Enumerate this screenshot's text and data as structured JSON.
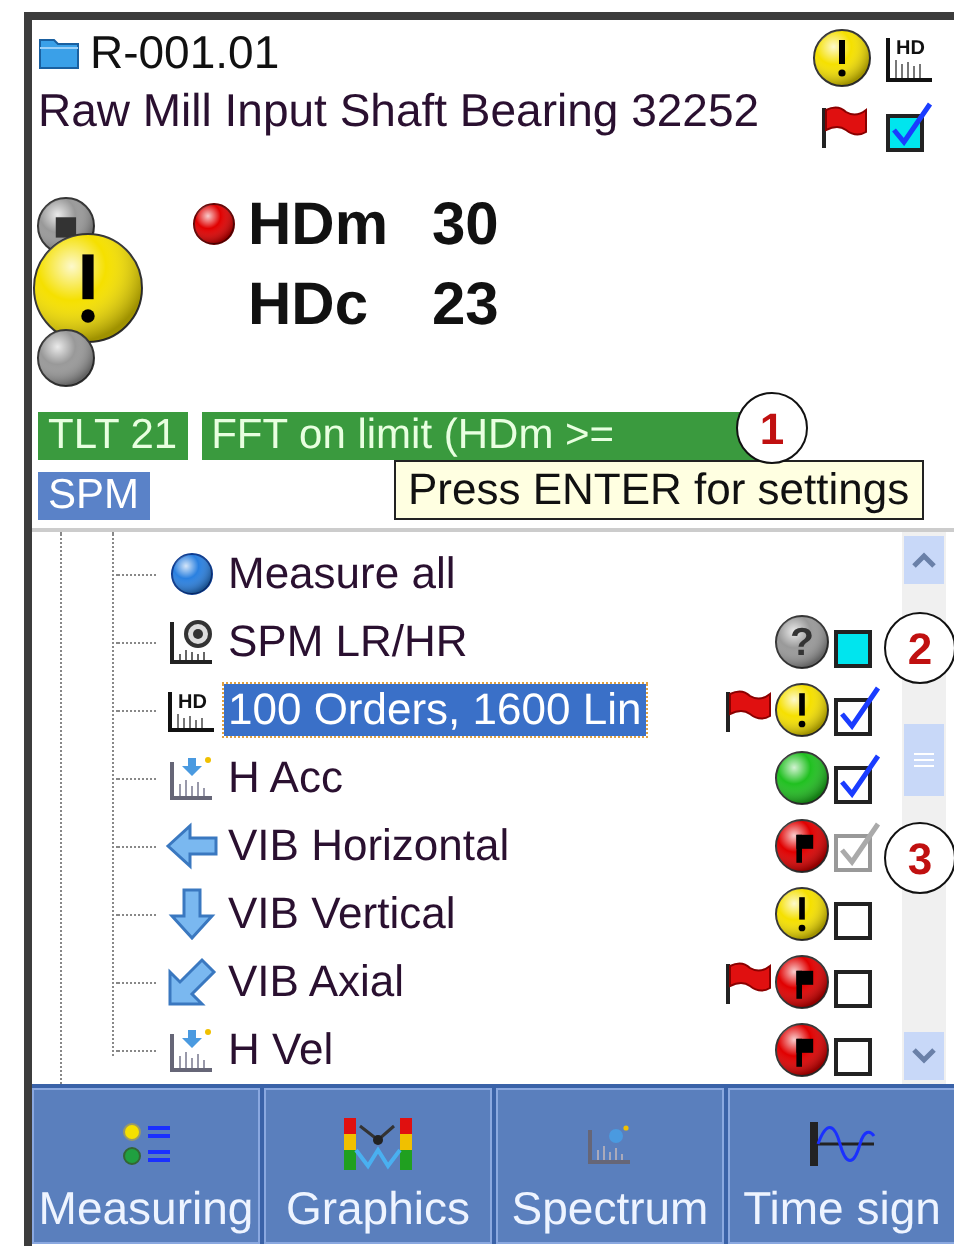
{
  "header": {
    "title": "R-001.01",
    "subtitle": "Raw Mill Input Shaft Bearing 32252",
    "color": "#f5e000",
    "icon_text": "HD",
    "flag": true,
    "checkbox": {
      "checked": true,
      "highlighted": true
    }
  },
  "readings": [
    {
      "label": "HDm",
      "value": "30",
      "alarm": true
    },
    {
      "label": "HDc",
      "value": "23",
      "alarm": false
    }
  ],
  "indicators": [
    {
      "color": "#999999",
      "symbol": "■"
    },
    {
      "color": "#f5e000"
    },
    {
      "color": "#999999"
    }
  ],
  "tags": [
    {
      "text": "TLT 21",
      "kind": "green"
    },
    {
      "text": "FFT on limit (HDm >=",
      "kind": "green"
    },
    {
      "text": "SPM",
      "kind": "blue"
    }
  ],
  "tooltip": "Press ENTER for settings",
  "tree": [
    {
      "label": "Measure all",
      "kind": "ball",
      "flag": false,
      "selected": false
    },
    {
      "label": "SPM LR/HR",
      "kind": "spm",
      "color": "#999999",
      "symbol": "?",
      "flag": false,
      "selected": false,
      "checkbox": {
        "checked": false,
        "disabled": false,
        "highlighted": true
      }
    },
    {
      "label": "100 Orders, 1600 Lin",
      "kind": "hd",
      "icon_text": "HD",
      "color": "#f5e000",
      "flag": true,
      "selected": true,
      "checkbox": {
        "checked": true,
        "disabled": false,
        "highlighted": false
      }
    },
    {
      "label": "H Acc",
      "kind": "chart",
      "color": "#20c020",
      "flag": false,
      "selected": false,
      "checkbox": {
        "checked": true,
        "disabled": false,
        "highlighted": false
      }
    },
    {
      "label": "VIB Horizontal",
      "kind": "arrow-left",
      "color": "#e00000",
      "flag": false,
      "selected": false,
      "checkbox": {
        "checked": true,
        "disabled": true,
        "highlighted": false
      }
    },
    {
      "label": "VIB Vertical",
      "kind": "arrow-down",
      "color": "#f5e000",
      "flag": false,
      "selected": false,
      "checkbox": {
        "checked": false,
        "disabled": false,
        "highlighted": false
      }
    },
    {
      "label": "VIB Axial",
      "kind": "arrow-diag",
      "color": "#e00000",
      "flag": true,
      "selected": false,
      "checkbox": {
        "checked": false,
        "disabled": false,
        "highlighted": false
      }
    },
    {
      "label": "H Vel",
      "kind": "chart",
      "color": "#e00000",
      "flag": false,
      "selected": false,
      "checkbox": {
        "checked": false,
        "disabled": false,
        "highlighted": false
      }
    }
  ],
  "toolbar": [
    {
      "label": "Measuring",
      "kind": "measuring"
    },
    {
      "label": "Graphics",
      "kind": "graphics"
    },
    {
      "label": "Spectrum",
      "kind": "spectrum"
    },
    {
      "label": "Time sign",
      "kind": "time"
    }
  ],
  "callouts": [
    "1",
    "2",
    "3"
  ]
}
